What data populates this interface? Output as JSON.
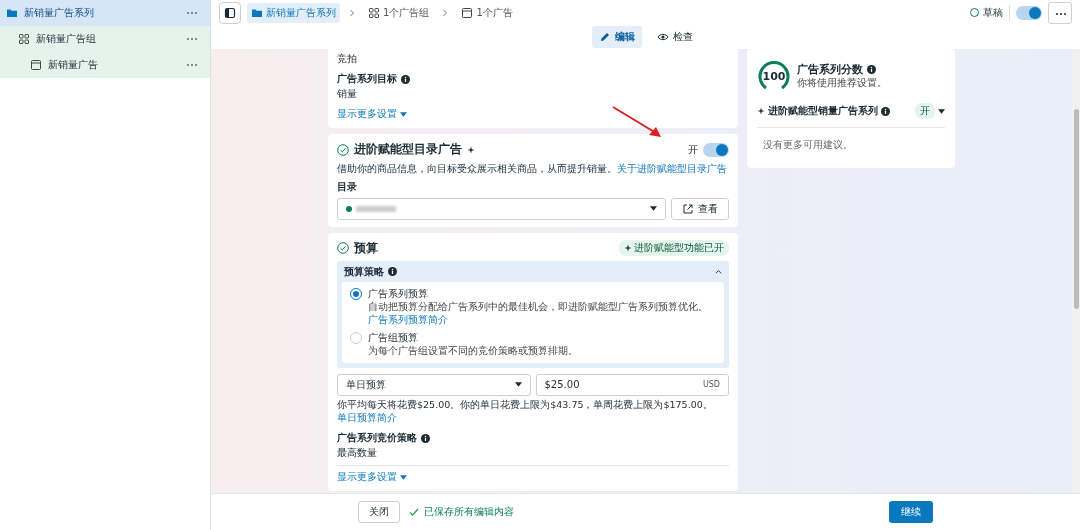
{
  "sidebar": {
    "items": [
      {
        "label": "新销量广告系列",
        "kind": "campaign",
        "selected": true,
        "children": [
          {
            "label": "新销量广告组",
            "kind": "adset",
            "selected": false,
            "children": [
              {
                "label": "新销量广告",
                "kind": "ad",
                "selected": false
              }
            ]
          }
        ]
      }
    ]
  },
  "breadcrumb": [
    {
      "label": "新销量广告系列",
      "kind": "campaign",
      "selected": true
    },
    {
      "label": "1个广告组",
      "kind": "adset",
      "selected": false
    },
    {
      "label": "1个广告",
      "kind": "ad",
      "selected": false
    }
  ],
  "status": {
    "label": "草稿"
  },
  "publish_toggle": {
    "on": true
  },
  "mode_tabs": [
    {
      "label": "编辑",
      "kind": "edit",
      "selected": true
    },
    {
      "label": "检查",
      "kind": "view",
      "selected": false
    }
  ],
  "settings_card": {
    "purchase_type_value": "竞拍",
    "objective": {
      "label": "广告系列目标",
      "value": "销量"
    },
    "more_link": "显示更多设置"
  },
  "catalog_card": {
    "title": "进阶赋能型目录广告",
    "toggle_label": "开",
    "on": true,
    "description": "借助你的商品信息，向目标受众展示相关商品，从而提升销量。",
    "link": "关于进阶赋能型目录广告",
    "catalog_label": "目录",
    "view_button": "查看"
  },
  "budget_card": {
    "title": "预算",
    "badge": "进阶赋能型功能已开",
    "strategy": {
      "label": "预算策略",
      "expanded": true,
      "options": [
        {
          "label": "广告系列预算",
          "description": "自动把预算分配给广告系列中的最佳机会，即进阶赋能型广告系列预算优化。",
          "link": "广告系列预算简介",
          "selected": true
        },
        {
          "label": "广告组预算",
          "description": "为每个广告组设置不同的竞价策略或预算排期。",
          "selected": false
        }
      ]
    },
    "budget_type": "单日预算",
    "amount": "$25.00",
    "currency": "USD",
    "note": "你平均每天将花费$25.00。你的单日花费上限为$43.75，单周花费上限为$175.00。",
    "note_link": "单日预算简介",
    "bid_strategy": {
      "label": "广告系列竞价策略",
      "value": "最高数量"
    },
    "more_link": "显示更多设置"
  },
  "score_card": {
    "score": "100",
    "title": "广告系列分数",
    "subtitle": "你将使用推荐设置。",
    "feature": "进阶赋能型销量广告系列",
    "feature_badge": "开",
    "empty_text": "没有更多可用建议。"
  },
  "footer": {
    "close_button": "关闭",
    "saved_text": "已保存所有编辑内容",
    "continue_button": "继续"
  }
}
